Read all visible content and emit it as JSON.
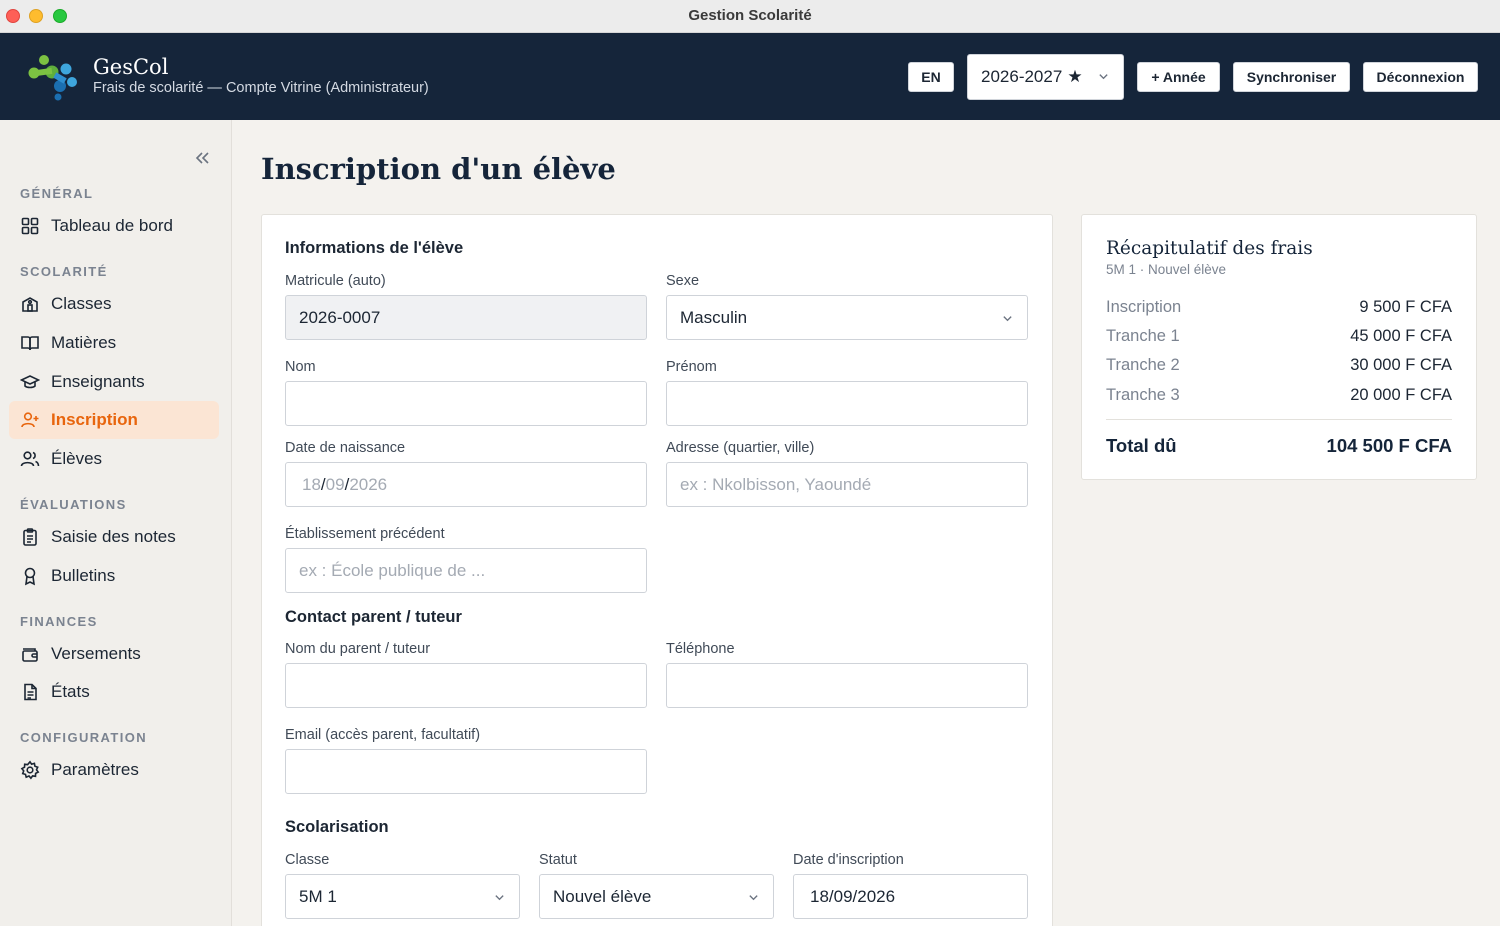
{
  "window": {
    "title": "Gestion Scolarité"
  },
  "header": {
    "brand_name": "GesCol",
    "brand_subtitle": "Frais de scolarité — Compte Vitrine (Administrateur)",
    "lang_button": "EN",
    "year_select": {
      "value": "2026-2027",
      "starred": true
    },
    "add_year_button": "+ Année",
    "sync_button": "Synchroniser",
    "logout_button": "Déconnexion",
    "logo_colors": [
      "#7cc242",
      "#3ea6dd",
      "#1b6fb0"
    ]
  },
  "sidebar": {
    "sections": [
      {
        "title": "GÉNÉRAL",
        "items": [
          {
            "label": "Tableau de bord",
            "icon": "grid-icon"
          }
        ]
      },
      {
        "title": "SCOLARITÉ",
        "items": [
          {
            "label": "Classes",
            "icon": "school-icon"
          },
          {
            "label": "Matières",
            "icon": "book-icon"
          },
          {
            "label": "Enseignants",
            "icon": "graduation-cap-icon"
          },
          {
            "label": "Inscription",
            "icon": "user-plus-icon",
            "active": true
          },
          {
            "label": "Élèves",
            "icon": "users-icon"
          }
        ]
      },
      {
        "title": "ÉVALUATIONS",
        "items": [
          {
            "label": "Saisie des notes",
            "icon": "clipboard-icon"
          },
          {
            "label": "Bulletins",
            "icon": "award-icon"
          }
        ]
      },
      {
        "title": "FINANCES",
        "items": [
          {
            "label": "Versements",
            "icon": "wallet-icon"
          },
          {
            "label": "États",
            "icon": "file-text-icon"
          }
        ]
      },
      {
        "title": "CONFIGURATION",
        "items": [
          {
            "label": "Paramètres",
            "icon": "gear-icon"
          }
        ]
      }
    ],
    "accent_color": "#e8650d"
  },
  "main": {
    "page_title": "Inscription d'un élève",
    "student_section": {
      "title": "Informations de l'élève",
      "matricule": {
        "label": "Matricule (auto)",
        "value": "2026-0007"
      },
      "sexe": {
        "label": "Sexe",
        "value": "Masculin"
      },
      "nom": {
        "label": "Nom",
        "value": ""
      },
      "prenom": {
        "label": "Prénom",
        "value": ""
      },
      "date_naissance": {
        "label": "Date de naissance",
        "day": "18",
        "month": "09",
        "year": "2026",
        "sep": "/"
      },
      "adresse": {
        "label": "Adresse (quartier, ville)",
        "placeholder": "ex : Nkolbisson, Yaoundé"
      },
      "etablissement": {
        "label": "Établissement précédent",
        "placeholder": "ex : École publique de ..."
      }
    },
    "contact_section": {
      "title": "Contact parent / tuteur",
      "parent_name": {
        "label": "Nom du parent / tuteur",
        "value": ""
      },
      "telephone": {
        "label": "Téléphone",
        "value": ""
      },
      "email": {
        "label": "Email (accès parent, facultatif)",
        "value": ""
      }
    },
    "schooling_section": {
      "title": "Scolarisation",
      "classe": {
        "label": "Classe",
        "value": "5M 1"
      },
      "statut": {
        "label": "Statut",
        "value": "Nouvel élève"
      },
      "date_inscription": {
        "label": "Date d'inscription",
        "value": "18/09/2026"
      }
    }
  },
  "summary": {
    "title": "Récapitulatif des frais",
    "subtitle": "5M 1 · Nouvel élève",
    "rows": [
      {
        "label": "Inscription",
        "value": "9 500 F CFA"
      },
      {
        "label": "Tranche 1",
        "value": "45 000 F CFA"
      },
      {
        "label": "Tranche 2",
        "value": "30 000 F CFA"
      },
      {
        "label": "Tranche 3",
        "value": "20 000 F CFA"
      }
    ],
    "total": {
      "label": "Total dû",
      "value": "104 500 F CFA"
    }
  }
}
